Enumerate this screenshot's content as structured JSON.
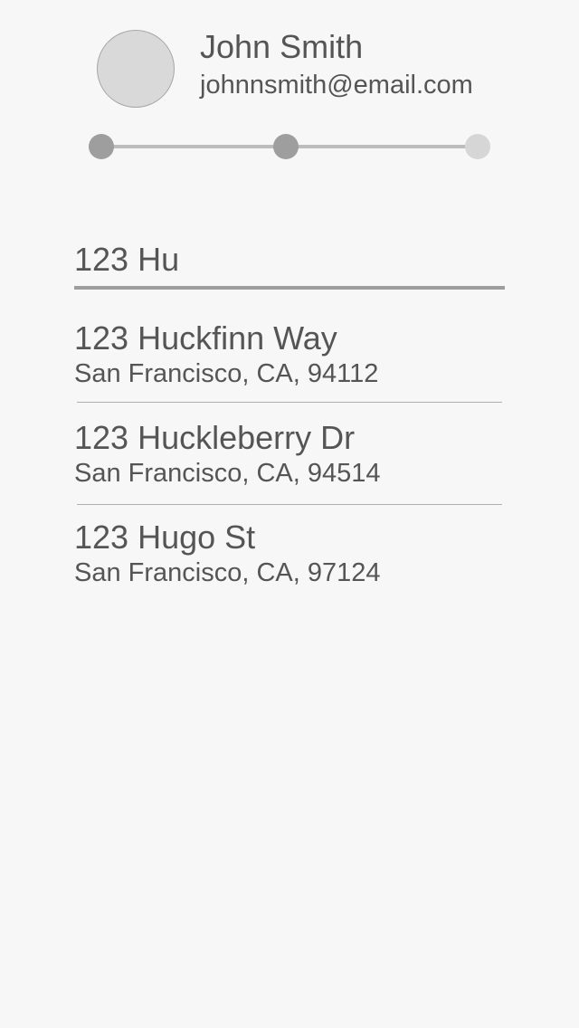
{
  "profile": {
    "name": "John Smith",
    "email": "johnnsmith@email.com"
  },
  "stepper": {
    "total_steps": 3,
    "completed_steps": 2
  },
  "address_search": {
    "value": "123 Hu"
  },
  "suggestions": [
    {
      "street": "123 Huckfinn Way",
      "city": "San Francisco, CA, 94112"
    },
    {
      "street": "123 Huckleberry Dr",
      "city": "San Francisco, CA, 94514"
    },
    {
      "street": "123 Hugo St",
      "city": "San Francisco, CA, 97124"
    }
  ],
  "colors": {
    "background": "#f7f7f7",
    "text": "#555555",
    "step_done": "#9e9e9e",
    "step_todo": "#d6d6d6"
  }
}
